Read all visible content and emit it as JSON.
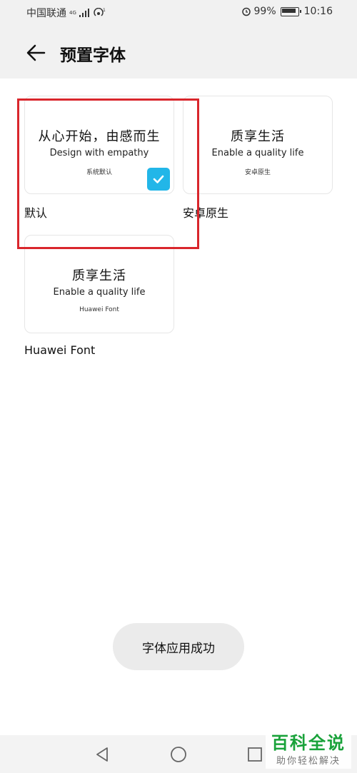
{
  "status_bar": {
    "carrier": "中国联通",
    "network_tag": "4G",
    "battery": "99%",
    "time": "10:16"
  },
  "header": {
    "title": "预置字体"
  },
  "fonts": [
    {
      "preview_cn": "从心开始，由感而生",
      "preview_en": "Design with empathy",
      "tag": "系统默认",
      "label": "默认",
      "selected": true
    },
    {
      "preview_cn": "质享生活",
      "preview_en": "Enable a quality life",
      "tag": "安卓原生",
      "label": "安卓原生",
      "selected": false
    },
    {
      "preview_cn": "质享生活",
      "preview_en": "Enable a quality life",
      "tag": "Huawei Font",
      "label": "Huawei Font",
      "selected": false
    }
  ],
  "toast": {
    "message": "字体应用成功"
  },
  "colors": {
    "accent": "#22b6e8",
    "highlight": "#d9262c",
    "watermark": "#19a23a"
  },
  "watermark": {
    "main": "百科全说",
    "sub": "助你轻松解决"
  }
}
